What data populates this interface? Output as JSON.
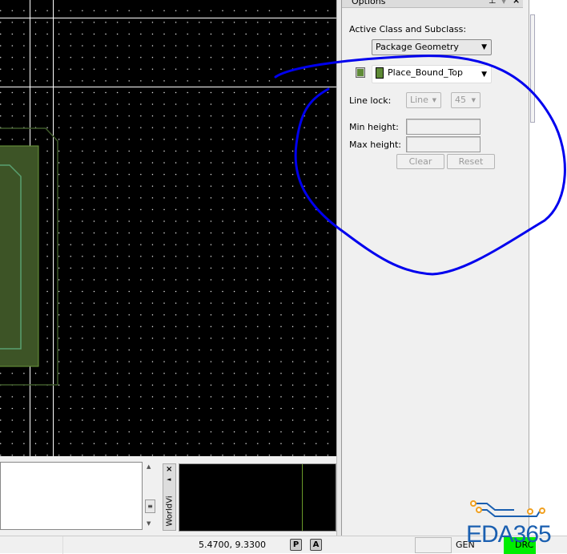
{
  "options": {
    "title": "Options",
    "active_class_label": "Active Class and Subclass:",
    "class_value": "Package Geometry",
    "subclass_value": "Place_Bound_Top",
    "subclass_color": "#5e8a36",
    "line_lock_label": "Line lock:",
    "line_lock_value": "Line",
    "angle_value": "45",
    "min_height_label": "Min height:",
    "max_height_label": "Max height:",
    "min_height_value": "",
    "max_height_value": "",
    "clear_label": "Clear",
    "reset_label": "Reset"
  },
  "worldview": {
    "tab_label": "WorldVi"
  },
  "status": {
    "coordinates": "5.4700, 9.3300",
    "p_button": "P",
    "a_button": "A",
    "mode": "GEN",
    "drc": "DRC"
  },
  "watermark": {
    "logo_text": "EDA365"
  },
  "colors": {
    "annotation": "#0000ee",
    "drc_ok": "#00ee00"
  }
}
